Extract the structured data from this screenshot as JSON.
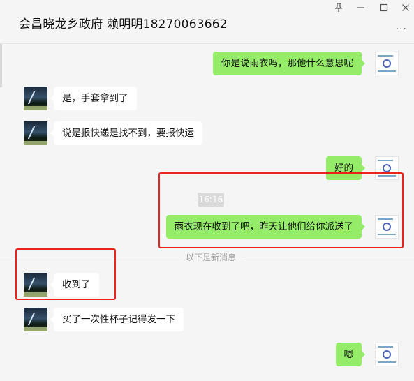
{
  "window": {
    "title": "会昌晓龙乡政府 赖明明18270063662",
    "pin_icon": "pin-icon",
    "minimize_icon": "minimize-icon",
    "maximize_icon": "maximize-icon",
    "close_icon": "close-icon",
    "more_icon": "more-dots-icon"
  },
  "messages": [
    {
      "side": "out",
      "text": "你是说雨衣吗，那他什么意思呢"
    },
    {
      "side": "in",
      "text": "是，手套拿到了"
    },
    {
      "side": "in",
      "text": "说是报快递是找不到，要报快运"
    },
    {
      "side": "out",
      "text": "好的"
    },
    {
      "side": "out",
      "text": "雨衣现在收到了吧，昨天让他们给你派送了"
    },
    {
      "side": "in",
      "text": "收到了"
    },
    {
      "side": "in",
      "text": "买了一次性杯子记得发一下"
    },
    {
      "side": "out",
      "text": "嗯"
    }
  ],
  "timestamp": "16:16",
  "new_messages_divider": "以下是新消息",
  "colors": {
    "outgoing_bubble": "#95ec69",
    "incoming_bubble": "#ffffff",
    "highlight_box": "#e8231c"
  }
}
